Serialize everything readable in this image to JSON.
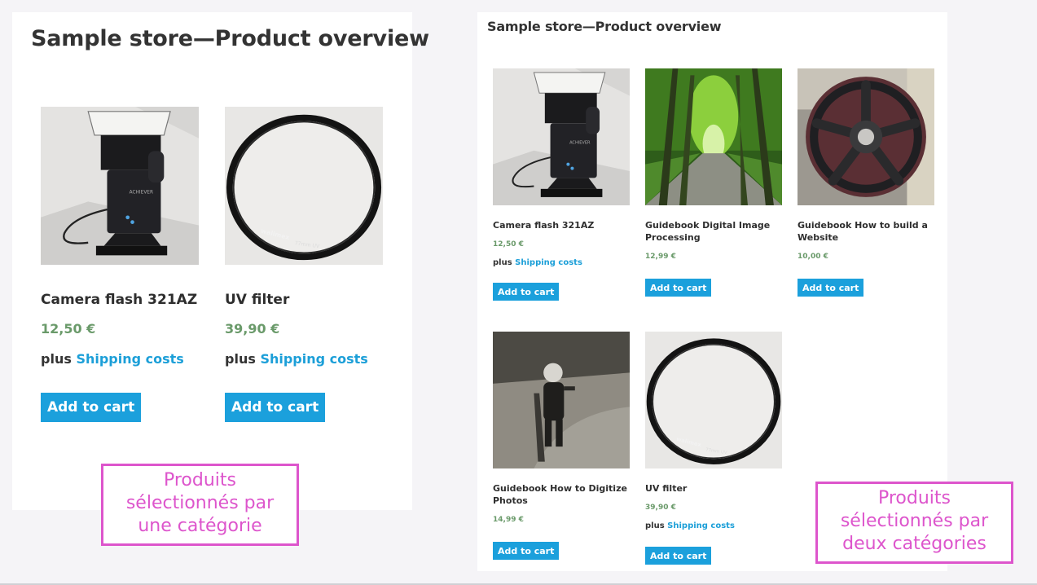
{
  "left": {
    "title": "Sample store—Product overview",
    "products": [
      {
        "title": "Camera flash 321AZ",
        "price": "12,50 €",
        "ship_prefix": "plus",
        "ship_link": "Shipping costs",
        "cart": "Add to cart"
      },
      {
        "title": "UV filter",
        "price": "39,90 €",
        "ship_prefix": "plus",
        "ship_link": "Shipping costs",
        "cart": "Add to cart"
      }
    ],
    "callout": [
      "Produits",
      "sélectionnés par",
      "une catégorie"
    ]
  },
  "right": {
    "title": "Sample store—Product overview",
    "products": [
      {
        "title": "Camera flash 321AZ",
        "price": "12,50 €",
        "ship_prefix": "plus",
        "ship_link": "Shipping costs",
        "cart": "Add to cart"
      },
      {
        "title": "Guidebook Digital Image Processing",
        "price": "12,99 €",
        "cart": "Add to cart"
      },
      {
        "title": "Guidebook How to build a Website",
        "price": "10,00 €",
        "cart": "Add to cart"
      },
      {
        "title": "Guidebook How to Digitize Photos",
        "price": "14,99 €",
        "cart": "Add to cart"
      },
      {
        "title": "UV filter",
        "price": "39,90 €",
        "ship_prefix": "plus",
        "ship_link": "Shipping costs",
        "cart": "Add to cart"
      }
    ],
    "callout": [
      "Produits",
      "sélectionnés par",
      "deux catégories"
    ]
  },
  "colors": {
    "accent": "#1ba0dc",
    "price": "#6a9a6a",
    "callout": "#dd55cc"
  },
  "images": [
    "camera-flash",
    "uv-filter",
    "green-tree-avenue",
    "rusty-valve-wheel",
    "child-vintage-photo"
  ]
}
